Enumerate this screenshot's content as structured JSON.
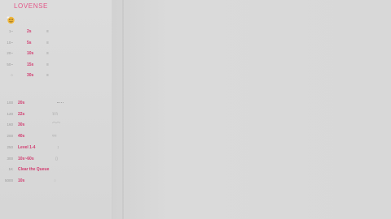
{
  "brand": {
    "name": "LOVENSE"
  },
  "levels_top": [
    {
      "duration": "2s"
    },
    {
      "duration": "5s"
    },
    {
      "duration": "10s"
    },
    {
      "duration": "15s"
    },
    {
      "duration": "30s"
    }
  ],
  "levels_bottom": [
    {
      "tokens": "100",
      "duration": "20s"
    },
    {
      "tokens": "120",
      "duration": "22s"
    },
    {
      "tokens": "160",
      "duration": "30s"
    },
    {
      "tokens": "200",
      "duration": "40s"
    },
    {
      "tokens": "250",
      "duration": "Level 1-4"
    },
    {
      "tokens": "300",
      "duration": "10s~60s"
    },
    {
      "tokens": "1K",
      "duration": "Clear the Queue"
    },
    {
      "tokens": "5000",
      "duration": "10s"
    }
  ],
  "colors": {
    "accent": "#d23a6e",
    "logo": "#e35587",
    "muted": "#9a9a9a",
    "background": "#d9d9d9"
  },
  "icons": [
    "lovense-emoji-icon",
    "vibration-icon",
    "wave-icon",
    "pattern-icon"
  ]
}
